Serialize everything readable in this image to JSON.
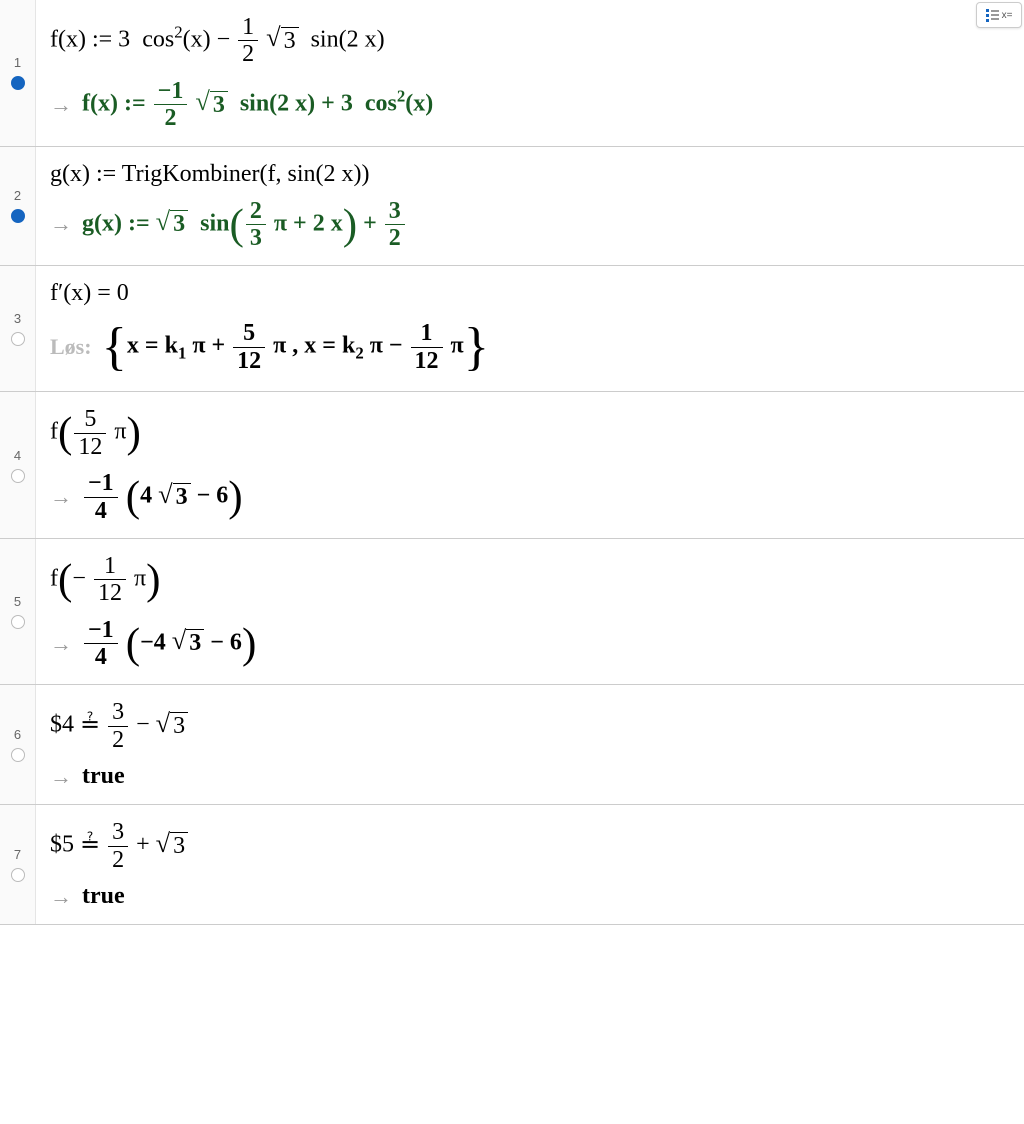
{
  "corner_button": "x=",
  "rows": [
    {
      "num": "1",
      "marker": "filled",
      "input_html": "f(x) := 3<span class='sp'></span> cos<sup>2</sup>(x) − <span class='frac'><span class='num'>1</span><span class='den'>2</span></span> <span class='sqrt'><span class='rad'>3</span></span><span class='sp'></span> sin(2 x)",
      "output_prefix": "→",
      "output_html": "f(x) := <span class='frac'><span class='num'>−1</span><span class='den'>2</span></span> <span class='sqrt'><span class='rad'>3</span></span><span class='sp'></span> sin(2 x) + 3<span class='sp'></span> cos<sup>2</sup>(x)",
      "output_color": "green"
    },
    {
      "num": "2",
      "marker": "filled",
      "input_html": "g(x) := TrigKombiner(f, sin(2 x))",
      "output_prefix": "→",
      "output_html": "g(x) := <span class='sqrt'><span class='rad'>3</span></span><span class='sp'></span> sin<span class='big-paren'>(</span><span class='frac'><span class='num'>2</span><span class='den'>3</span></span> π + 2 x<span class='big-paren'>)</span> + <span class='frac'><span class='num'>3</span><span class='den'>2</span></span>",
      "output_color": "green"
    },
    {
      "num": "3",
      "marker": "grey",
      "input_html": "f′(x) = 0",
      "output_prefix": "Løs:",
      "output_html": "<span class='big-brace'>{</span>x = k<sub>1</sub> π + <span class='frac'><span class='num'>5</span><span class='den'>12</span></span> π , x = k<sub>2</sub> π − <span class='frac'><span class='num'>1</span><span class='den'>12</span></span> π<span class='big-brace'>}</span>",
      "output_color": "black"
    },
    {
      "num": "4",
      "marker": "grey",
      "input_html": "f<span class='big-paren'>(</span><span class='frac'><span class='num'>5</span><span class='den'>12</span></span> π<span class='big-paren'>)</span>",
      "output_prefix": "→",
      "output_html": "<span class='frac'><span class='num'>−1</span><span class='den'>4</span></span> <span class='big-paren'>(</span>4 <span class='sqrt'><span class='rad'>3</span></span> − 6<span class='big-paren'>)</span>",
      "output_color": "black"
    },
    {
      "num": "5",
      "marker": "grey",
      "input_html": "f<span class='big-paren'>(</span>− <span class='frac'><span class='num'>1</span><span class='den'>12</span></span> π<span class='big-paren'>)</span>",
      "output_prefix": "→",
      "output_html": "<span class='frac'><span class='num'>−1</span><span class='den'>4</span></span> <span class='big-paren'>(</span>−4 <span class='sqrt'><span class='rad'>3</span></span> − 6<span class='big-paren'>)</span>",
      "output_color": "black"
    },
    {
      "num": "6",
      "marker": "grey",
      "input_html": "$4 <span style='position:relative;'>≟</span> <span class='frac'><span class='num'>3</span><span class='den'>2</span></span> − <span class='sqrt'><span class='rad'>3</span></span>",
      "output_prefix": "→",
      "output_html": "true",
      "output_color": "black"
    },
    {
      "num": "7",
      "marker": "grey",
      "input_html": "$5 <span style='position:relative;'>≟</span> <span class='frac'><span class='num'>3</span><span class='den'>2</span></span> + <span class='sqrt'><span class='rad'>3</span></span>",
      "output_prefix": "→",
      "output_html": "true",
      "output_color": "black"
    }
  ]
}
